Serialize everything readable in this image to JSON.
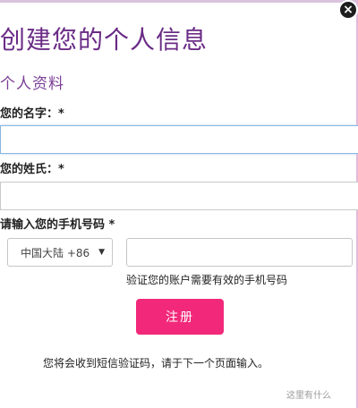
{
  "dialog": {
    "close_symbol": "×",
    "title": "创建您的个人信息",
    "section_title": "个人资料"
  },
  "form": {
    "first_name_label": "您的名字：*",
    "first_name_value": "",
    "last_name_label": "您的姓氏：*",
    "last_name_value": "",
    "phone_label": "请输入您的手机号码 *",
    "country_code": "中国大陆 +86",
    "phone_value": "",
    "phone_hint": "验证您的账户需要有效的手机号码",
    "register_button": "注册",
    "bottom_note": "您将会收到短信验证码，请于下一个页面输入。"
  },
  "watermark": "这里有什么",
  "colors": {
    "title": "#6a2b86",
    "accent_button": "#f2297a",
    "focus_border": "#8ab6e0"
  }
}
